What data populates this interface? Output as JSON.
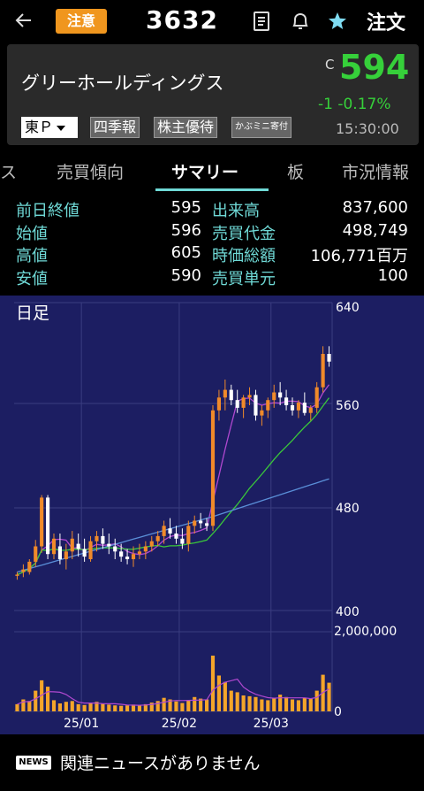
{
  "header": {
    "caution_badge": "注意",
    "stock_code": "3632",
    "order_label": "注文"
  },
  "stock": {
    "name": "グリーホールディングス",
    "close_flag": "C",
    "price": "594",
    "change": "-1  -0.17%",
    "time": "15:30:00",
    "market": "東Ｐ",
    "tags": [
      "四季報",
      "株主優待",
      "かぶミニ寄付"
    ]
  },
  "tabs": [
    "ス",
    "売買傾向",
    "サマリー",
    "板",
    "市況情報"
  ],
  "active_tab": "サマリー",
  "stats": {
    "left": [
      {
        "label": "前日終値",
        "value": "595"
      },
      {
        "label": "始値",
        "value": "596"
      },
      {
        "label": "高値",
        "value": "605"
      },
      {
        "label": "安値",
        "value": "590"
      }
    ],
    "right": [
      {
        "label": "出来高",
        "value": "837,600"
      },
      {
        "label": "売買代金",
        "value": "498,749"
      },
      {
        "label": "時価総額",
        "value": "106,771百万"
      },
      {
        "label": "売買単元",
        "value": "100"
      }
    ]
  },
  "chart_data": {
    "type": "candlestick",
    "title": "日足",
    "price_ticks": [
      "640",
      "560",
      "480",
      "400"
    ],
    "ylim": [
      400,
      640
    ],
    "volume_ticks": [
      "2,000,000",
      "0"
    ],
    "volume_max": 2000000,
    "x_ticks": [
      "25/01",
      "25/02",
      "25/03"
    ],
    "colors": {
      "up": "#f08a2a",
      "down": "#ffffff",
      "ma_short": "#b048d0",
      "ma_mid": "#3ac83a",
      "ma_long": "#5a8fd8",
      "volume": "#f4a52a"
    },
    "candles": [
      [
        428,
        430,
        424,
        428
      ],
      [
        430,
        436,
        426,
        432
      ],
      [
        430,
        440,
        428,
        438
      ],
      [
        438,
        455,
        434,
        450
      ],
      [
        450,
        490,
        445,
        488
      ],
      [
        488,
        490,
        440,
        444
      ],
      [
        444,
        460,
        440,
        456
      ],
      [
        450,
        460,
        436,
        440
      ],
      [
        440,
        452,
        432,
        446
      ],
      [
        446,
        462,
        440,
        456
      ],
      [
        452,
        460,
        442,
        448
      ],
      [
        448,
        456,
        438,
        442
      ],
      [
        440,
        458,
        438,
        454
      ],
      [
        454,
        462,
        446,
        458
      ],
      [
        458,
        464,
        448,
        452
      ],
      [
        452,
        460,
        444,
        450
      ],
      [
        450,
        456,
        440,
        446
      ],
      [
        446,
        452,
        438,
        442
      ],
      [
        442,
        448,
        436,
        440
      ],
      [
        440,
        450,
        434,
        444
      ],
      [
        444,
        452,
        440,
        446
      ],
      [
        446,
        454,
        440,
        450
      ],
      [
        450,
        458,
        446,
        454
      ],
      [
        454,
        462,
        450,
        458
      ],
      [
        458,
        470,
        452,
        466
      ],
      [
        464,
        472,
        456,
        460
      ],
      [
        460,
        466,
        452,
        456
      ],
      [
        456,
        464,
        448,
        452
      ],
      [
        452,
        470,
        446,
        466
      ],
      [
        466,
        474,
        460,
        470
      ],
      [
        470,
        476,
        464,
        468
      ],
      [
        468,
        472,
        462,
        466
      ],
      [
        466,
        560,
        462,
        556
      ],
      [
        556,
        572,
        548,
        566
      ],
      [
        566,
        580,
        556,
        572
      ],
      [
        572,
        576,
        560,
        564
      ],
      [
        564,
        572,
        554,
        558
      ],
      [
        558,
        568,
        550,
        566
      ],
      [
        566,
        574,
        560,
        568
      ],
      [
        568,
        572,
        548,
        552
      ],
      [
        552,
        560,
        544,
        556
      ],
      [
        556,
        566,
        550,
        564
      ],
      [
        564,
        576,
        558,
        570
      ],
      [
        570,
        578,
        560,
        566
      ],
      [
        566,
        572,
        556,
        560
      ],
      [
        560,
        566,
        552,
        556
      ],
      [
        556,
        564,
        550,
        562
      ],
      [
        562,
        570,
        552,
        554
      ],
      [
        554,
        560,
        548,
        558
      ],
      [
        558,
        578,
        554,
        574
      ],
      [
        574,
        606,
        570,
        600
      ],
      [
        600,
        606,
        590,
        594
      ]
    ],
    "volumes": [
      180000,
      300000,
      260000,
      520000,
      780000,
      620000,
      280000,
      200000,
      240000,
      260000,
      180000,
      160000,
      200000,
      240000,
      190000,
      170000,
      150000,
      140000,
      150000,
      170000,
      160000,
      180000,
      220000,
      260000,
      340000,
      300000,
      250000,
      210000,
      280000,
      360000,
      320000,
      300000,
      1400000,
      900000,
      740000,
      520000,
      480000,
      400000,
      380000,
      360000,
      300000,
      280000,
      340000,
      420000,
      360000,
      300000,
      280000,
      340000,
      320000,
      520000,
      920000,
      720000
    ]
  },
  "news": {
    "badge": "NEWS",
    "text": "関連ニュースがありません"
  }
}
